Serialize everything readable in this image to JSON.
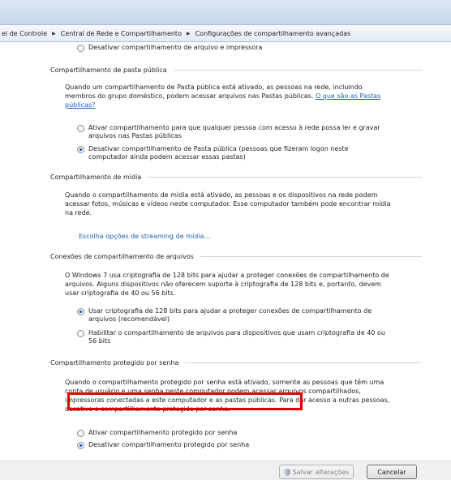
{
  "address": {
    "crumbs": [
      "el de Controle",
      "Central de Rede e Compartilhamento",
      "Configurações de compartilhamento avançadas"
    ]
  },
  "top_option": {
    "label": "Desativar compartilhamento de arquivo e impressora"
  },
  "public_folder": {
    "title": "Compartilhamento de pasta pública",
    "desc_line1": "Quando um compartilhamento de Pasta pública está ativado, as pessoas na rede, incluindo",
    "desc_line2": "membros do grupo doméstico, podem acessar arquivos nas Pastas públicas.",
    "link_part1": "O que são as Pastas",
    "link_part2": "públicas?",
    "opt_on_l1": "Ativar compartilhamento para que qualquer pessoa com acesso à rede possa ler e gravar",
    "opt_on_l2": "arquivos nas Pastas públicas",
    "opt_off_l1": "Desativar compartilhamento de Pasta pública (pessoas que fizeram logon neste",
    "opt_off_l2": "computador ainda podem acessar essas pastas)"
  },
  "media": {
    "title": "Compartilhamento de mídia",
    "desc_line1": "Quando o compartilhamento de mídia está ativado, as pessoas e os dispositivos na rede podem",
    "desc_line2": "acessar fotos, músicas e vídeos neste computador. Esse computador também pode encontrar mídia",
    "desc_line3": "na rede.",
    "link": "Escolha opções de streaming de mídia..."
  },
  "file_conn": {
    "title": "Conexões de compartilhamento de arquivos",
    "desc_line1": "O Windows 7 usa criptografia de 128 bits para ajudar a proteger conexões de compartilhamento de",
    "desc_line2": "arquivos. Alguns dispositivos não oferecem suporte à criptografia de 128 bits e, portanto, devem",
    "desc_line3": "usar criptografia de 40 ou 56 bits.",
    "opt128_l1": "Usar criptografia de 128 bits para ajudar a proteger conexões de compartilhamento de",
    "opt128_l2": "arquivos (recomendável)",
    "opt40_l1": "Habilitar o compartilhamento de arquivos para dispositivos que usam criptografia de 40 ou",
    "opt40_l2": "56 bits"
  },
  "password": {
    "title": "Compartilhamento protegido por senha",
    "desc_line1": "Quando o compartilhamento protegido por senha está ativado, somente as pessoas que têm uma",
    "desc_line2": "conta de usuário e uma senha neste computador podem acessar arquivos compartilhados,",
    "desc_line3": "impressoras conectadas a este computador e as pastas públicas. Para dar acesso a outras pessoas,",
    "desc_line4": "desative o compartilhamento protegido por senha.",
    "opt_on": "Ativar compartilhamento protegido por senha",
    "opt_off": "Desativar compartilhamento protegido por senha"
  },
  "footer": {
    "save": "Salvar alterações",
    "cancel": "Cancelar"
  },
  "colors": {
    "link": "#1a5fb4",
    "highlight": "#e00000"
  }
}
